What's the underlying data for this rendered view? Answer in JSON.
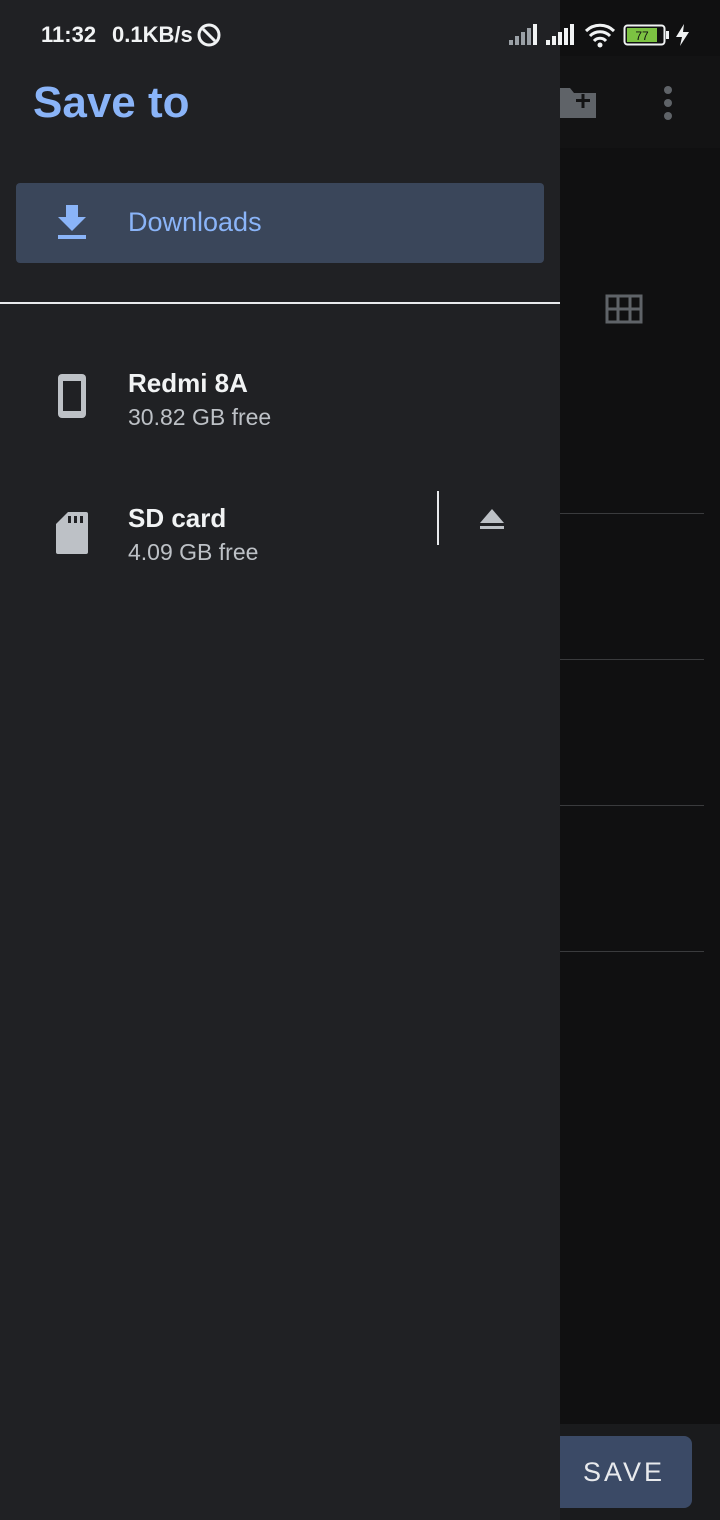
{
  "status_bar": {
    "time": "11:32",
    "net_speed": "0.1KB/s",
    "battery_level": "77"
  },
  "background": {
    "save_label": "SAVE"
  },
  "drawer": {
    "title": "Save to",
    "downloads_label": "Downloads",
    "roots": [
      {
        "name": "Redmi 8A",
        "summary": "30.82 GB free",
        "icon": "phone-icon"
      },
      {
        "name": "SD card",
        "summary": "4.09 GB free",
        "icon": "sd-card-icon"
      }
    ]
  },
  "colors": {
    "accent": "#8ab4f8",
    "drawer_bg": "#202124",
    "selected_bg": "#3a465a"
  }
}
